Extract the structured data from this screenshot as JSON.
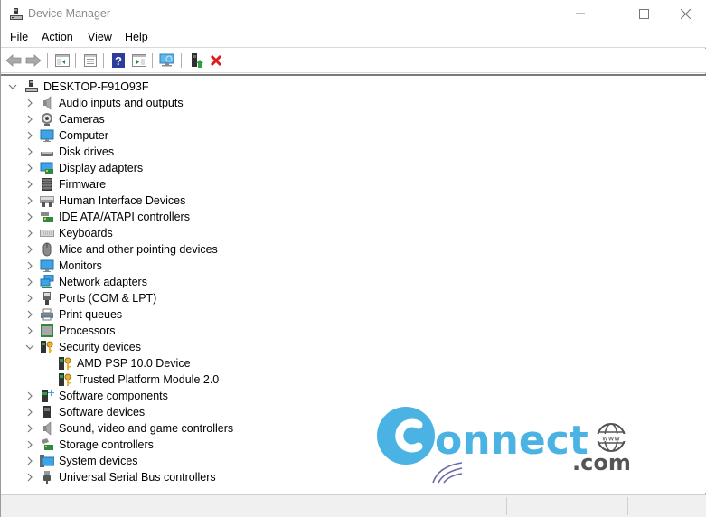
{
  "window": {
    "title": "Device Manager",
    "controls": {
      "minimize": "minimize",
      "maximize": "maximize",
      "close": "close"
    }
  },
  "menu": {
    "items": [
      "File",
      "Action",
      "View",
      "Help"
    ]
  },
  "toolbar": {
    "buttons": [
      {
        "name": "back",
        "icon": "back-arrow-icon",
        "enabled": false
      },
      {
        "name": "forward",
        "icon": "forward-arrow-icon",
        "enabled": false
      },
      {
        "name": "show-hide-console-tree",
        "icon": "console-tree-icon"
      },
      {
        "name": "properties",
        "icon": "properties-icon"
      },
      {
        "name": "help",
        "icon": "help-icon"
      },
      {
        "name": "show-hide-action-pane",
        "icon": "action-pane-icon"
      },
      {
        "name": "scan-for-hardware-changes",
        "icon": "scan-hardware-icon"
      },
      {
        "name": "update-driver",
        "icon": "update-driver-icon"
      },
      {
        "name": "uninstall-device",
        "icon": "uninstall-icon"
      }
    ]
  },
  "tree": {
    "root": {
      "label": "DESKTOP-F91O93F",
      "expanded": true,
      "icon": "computer-root-icon"
    },
    "categories": [
      {
        "label": "Audio inputs and outputs",
        "icon": "speaker-icon",
        "expanded": false
      },
      {
        "label": "Cameras",
        "icon": "camera-icon",
        "expanded": false
      },
      {
        "label": "Computer",
        "icon": "monitor-icon",
        "expanded": false
      },
      {
        "label": "Disk drives",
        "icon": "disk-drive-icon",
        "expanded": false
      },
      {
        "label": "Display adapters",
        "icon": "display-adapter-icon",
        "expanded": false
      },
      {
        "label": "Firmware",
        "icon": "firmware-chip-icon",
        "expanded": false
      },
      {
        "label": "Human Interface Devices",
        "icon": "hid-icon",
        "expanded": false
      },
      {
        "label": "IDE ATA/ATAPI controllers",
        "icon": "ide-controller-icon",
        "expanded": false
      },
      {
        "label": "Keyboards",
        "icon": "keyboard-icon",
        "expanded": false
      },
      {
        "label": "Mice and other pointing devices",
        "icon": "mouse-icon",
        "expanded": false
      },
      {
        "label": "Monitors",
        "icon": "monitor-icon",
        "expanded": false
      },
      {
        "label": "Network adapters",
        "icon": "network-adapter-icon",
        "expanded": false
      },
      {
        "label": "Ports (COM & LPT)",
        "icon": "port-icon",
        "expanded": false
      },
      {
        "label": "Print queues",
        "icon": "printer-icon",
        "expanded": false
      },
      {
        "label": "Processors",
        "icon": "processor-icon",
        "expanded": false
      },
      {
        "label": "Security devices",
        "icon": "security-key-icon",
        "expanded": true,
        "children": [
          {
            "label": "AMD PSP 10.0 Device",
            "icon": "security-key-icon"
          },
          {
            "label": "Trusted Platform Module 2.0",
            "icon": "security-key-icon"
          }
        ]
      },
      {
        "label": "Software components",
        "icon": "software-component-icon",
        "expanded": false
      },
      {
        "label": "Software devices",
        "icon": "software-device-icon",
        "expanded": false
      },
      {
        "label": "Sound, video and game controllers",
        "icon": "speaker-icon",
        "expanded": false
      },
      {
        "label": "Storage controllers",
        "icon": "storage-controller-icon",
        "expanded": false
      },
      {
        "label": "System devices",
        "icon": "system-devices-icon",
        "expanded": false
      },
      {
        "label": "Universal Serial Bus controllers",
        "icon": "usb-icon",
        "expanded": false
      }
    ]
  },
  "watermark": {
    "text": "onnect",
    "suffix": ".com",
    "globe_text": "www",
    "brand_color": "#4ab3e3",
    "text_color": "#555555"
  },
  "colors": {
    "accent_blue": "#3c8fd8",
    "uninstall_red": "#d81e1e",
    "update_green": "#2ea043"
  }
}
